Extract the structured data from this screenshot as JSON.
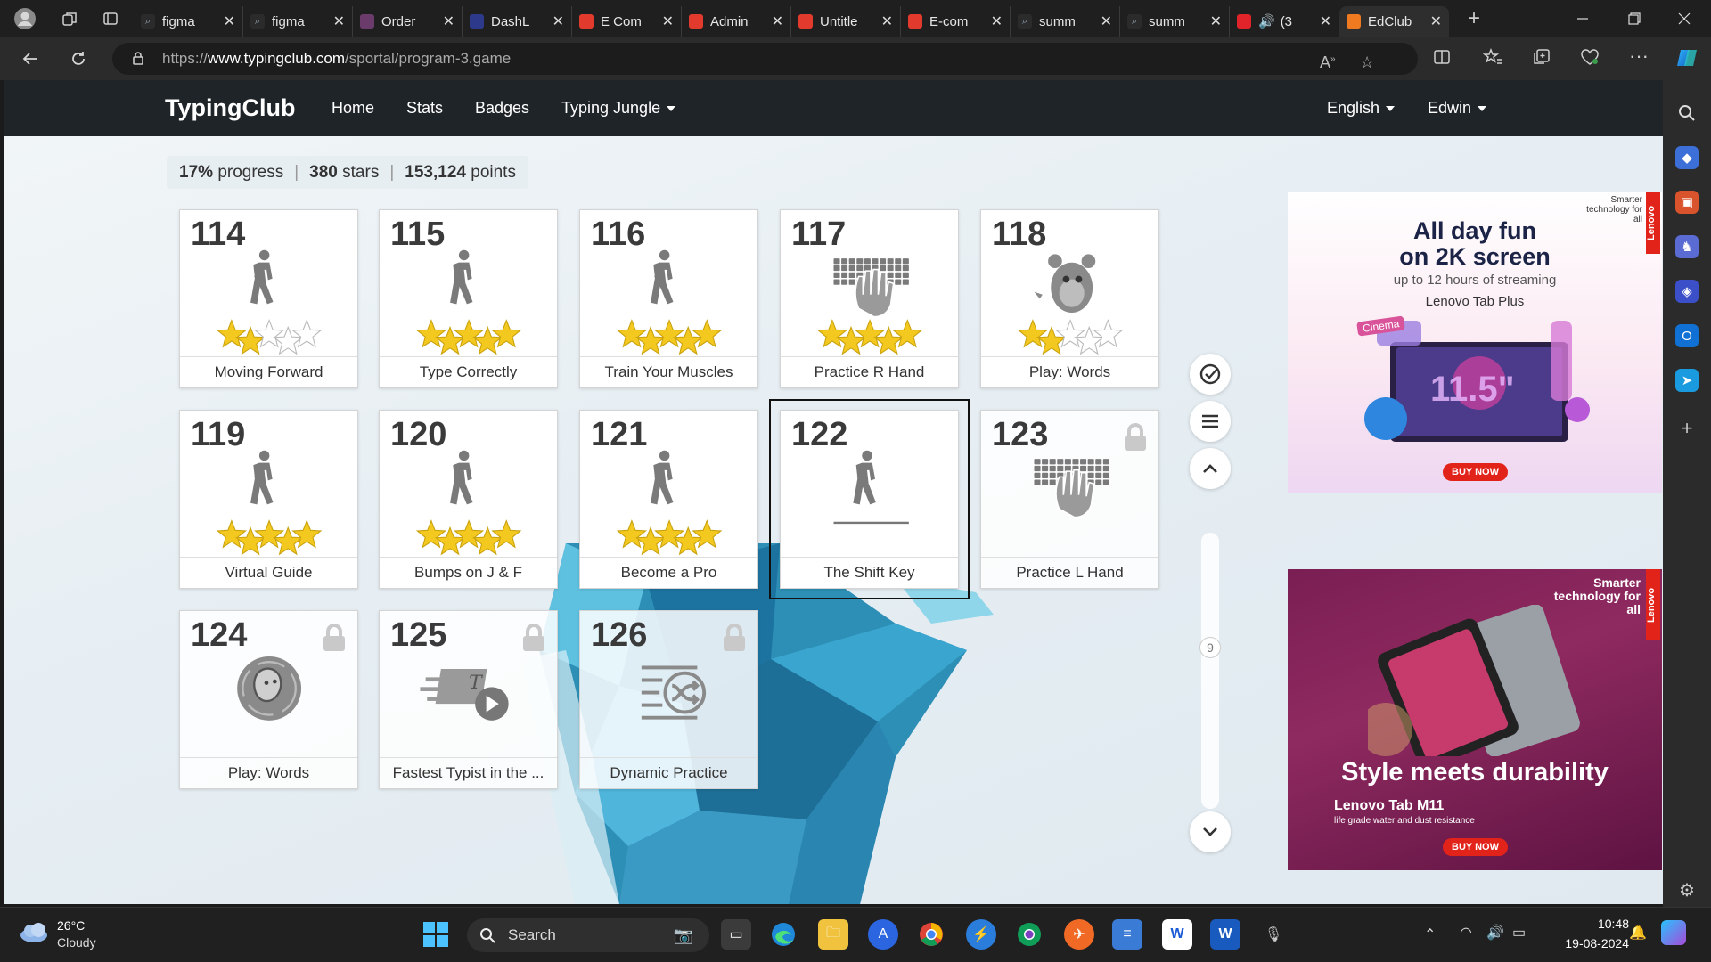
{
  "browser": {
    "tabs": [
      {
        "title": "figma",
        "fav_color": "#2b2b2b",
        "icon": "search-icon"
      },
      {
        "title": "figma",
        "fav_color": "#2b2b2b",
        "icon": "search-icon"
      },
      {
        "title": "Order",
        "fav_color": "#6b3b6b",
        "icon": "globe-icon"
      },
      {
        "title": "DashL",
        "fav_color": "#2d3a8c",
        "icon": "hexagon-icon"
      },
      {
        "title": "E Com",
        "fav_color": "#e23b2e",
        "icon": "figma-icon"
      },
      {
        "title": "Admin",
        "fav_color": "#e23b2e",
        "icon": "figma-icon"
      },
      {
        "title": "Untitle",
        "fav_color": "#e23b2e",
        "icon": "figma-icon"
      },
      {
        "title": "E-com",
        "fav_color": "#e23b2e",
        "icon": "figma-icon"
      },
      {
        "title": "summ",
        "fav_color": "#2b2b2b",
        "icon": "search-icon"
      },
      {
        "title": "summ",
        "fav_color": "#2b2b2b",
        "icon": "search-icon"
      },
      {
        "title": "(3",
        "fav_color": "#e0242a",
        "icon": "youtube-icon"
      },
      {
        "title": "EdClub",
        "fav_color": "#f07a20",
        "icon": "edclub-icon",
        "active": true
      }
    ],
    "url_prefix": "https://",
    "url_host": "www.typingclub.com",
    "url_path": "/sportal/program-3.game"
  },
  "site": {
    "brand": "TypingClub",
    "nav": [
      "Home",
      "Stats",
      "Badges",
      "Typing Jungle"
    ],
    "language": "English",
    "user": "Edwin"
  },
  "progress": {
    "percent": "17%",
    "percent_label": "progress",
    "stars": "380",
    "stars_label": "stars",
    "points": "153,124",
    "points_label": "points"
  },
  "lessons": [
    {
      "num": "114",
      "label": "Moving Forward",
      "art": "walker",
      "stars": 2,
      "locked": false
    },
    {
      "num": "115",
      "label": "Type Correctly",
      "art": "walker",
      "stars": 5,
      "locked": false
    },
    {
      "num": "116",
      "label": "Train Your Muscles",
      "art": "walker",
      "stars": 5,
      "locked": false
    },
    {
      "num": "117",
      "label": "Practice R Hand",
      "art": "keyboard-hand",
      "stars": 5,
      "locked": false
    },
    {
      "num": "118",
      "label": "Play: Words",
      "art": "monster",
      "stars": 2,
      "locked": false
    },
    {
      "num": "119",
      "label": "Virtual Guide",
      "art": "walker",
      "stars": 5,
      "locked": false
    },
    {
      "num": "120",
      "label": "Bumps on J & F",
      "art": "walker",
      "stars": 5,
      "locked": false
    },
    {
      "num": "121",
      "label": "Become a Pro",
      "art": "walker",
      "stars": 5,
      "locked": false
    },
    {
      "num": "122",
      "label": "The Shift Key",
      "art": "walker-line",
      "stars": 0,
      "locked": false,
      "selected": true
    },
    {
      "num": "123",
      "label": "Practice L Hand",
      "art": "keyboard-hand",
      "stars": 0,
      "locked": true
    },
    {
      "num": "124",
      "label": "Play: Words",
      "art": "monster-circle",
      "stars": 0,
      "locked": true
    },
    {
      "num": "125",
      "label": "Fastest Typist in the ...",
      "art": "speed-play",
      "stars": 0,
      "locked": true
    },
    {
      "num": "126",
      "label": "Dynamic Practice",
      "art": "shuffle",
      "stars": 0,
      "locked": true
    }
  ],
  "side_controls": {
    "scroll_number": "9"
  },
  "ads": {
    "ad1": {
      "tagline": "Smarter technology for all",
      "headline1": "All day fun",
      "headline2": "on 2K screen",
      "sub": "up to 12 hours of streaming",
      "product": "Lenovo Tab Plus",
      "screen": "11.5\"",
      "screen_badge": "Cinema",
      "cta": "BUY NOW",
      "brand": "Lenovo"
    },
    "ad2": {
      "tagline": "Smarter technology for all",
      "headline": "Style meets durability",
      "product": "Lenovo Tab M11",
      "sub": "life grade water and dust resistance",
      "cta": "BUY NOW",
      "brand": "Lenovo"
    }
  },
  "taskbar": {
    "weather_temp": "26°C",
    "weather_desc": "Cloudy",
    "search_label": "Search",
    "time": "10:48",
    "date": "19-08-2024"
  },
  "colors": {
    "star": "#f3c81f",
    "site_nav": "#1f2429",
    "accent_ice": "#2d8fb6"
  }
}
